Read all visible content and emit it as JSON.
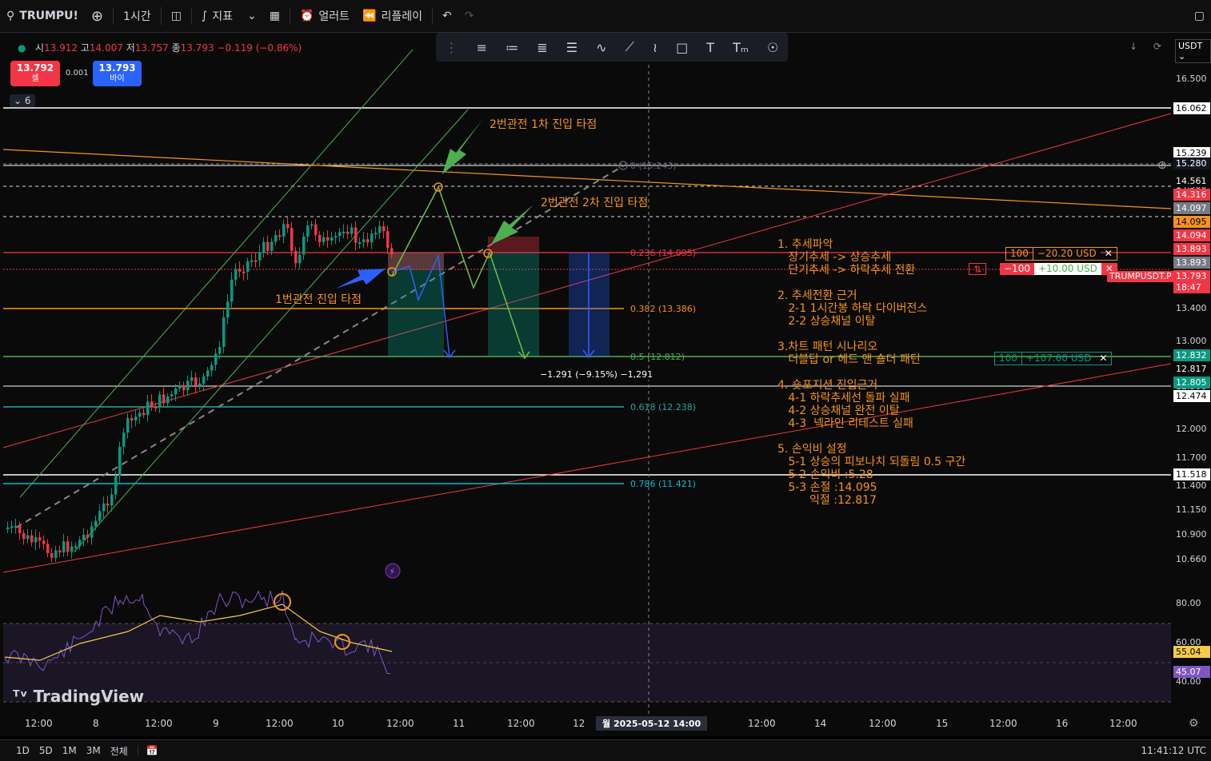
{
  "toolbar": {
    "symbol": "TRUMPU!",
    "interval": "1시간",
    "indicators": "지표",
    "alert": "얼러트",
    "replay": "리플레이"
  },
  "legend": {
    "open_label": "시",
    "open": "13.912",
    "high_label": "고",
    "high": "14.007",
    "low_label": "저",
    "low": "13.757",
    "close_label": "종",
    "close": "13.793",
    "change": "−0.119 (−0.86%)"
  },
  "trade": {
    "sell_price": "13.792",
    "sell_label": "셀",
    "spread": "0.001",
    "buy_price": "13.793",
    "buy_label": "바이"
  },
  "indicator_count": "6",
  "currency": "USDT",
  "fib_labels": [
    {
      "text": "0 (15.243)"
    },
    {
      "text": "0.236 (14.095)"
    },
    {
      "text": "0.382 (13.386)"
    },
    {
      "text": "0.5 (12.812)"
    },
    {
      "text": "0.618 (12.238)"
    },
    {
      "text": "0.786 (11.421)"
    }
  ],
  "measure": "−1.291 (−9.15%) −1,291",
  "annotations": {
    "entry1": "1번관전 진입 타점",
    "entry2_first": "2번관전 1차 진입 타점",
    "entry2_second": "2번관전 2차 진입 타점",
    "analysis": "1. 추세파악\n   장기추세 -> 상승추세\n   단기추세 -> 하락추세 전환\n\n2. 추세전환 근거\n   2-1 1시간봉 하락 다이버전스\n   2-2 상승채널 이탈\n\n3.차트 패턴 시나리오\n   더블탑 or 헤드 앤 숄더 패턴\n\n4. 숏포지션 진입근거\n   4-1 하락추세선 돌파 실패\n   4-2 상승채널 완전 이탈\n   4-3  넥라인 리테스트 실패\n\n5. 손익비 설정\n   5-1 상승의 피보나치 되돌림 0.5 구간\n   5-2 손익비 :5.28\n   5-3 손절 :14.095\n         익절 :12.817"
  },
  "positions": [
    {
      "qty": "100",
      "pnl": "−20.20 USD"
    },
    {
      "qty": "−100",
      "pnl": "+10.00 USD"
    },
    {
      "qty": "100",
      "pnl": "+107.60 USD"
    }
  ],
  "price_axis": {
    "ticks": [
      "16.500",
      "15.500",
      "14.500",
      "13.400",
      "13.000",
      "12.500",
      "12.000",
      "11.700",
      "11.400",
      "11.150",
      "10.900",
      "10.660",
      "80.00",
      "60.00",
      "40.00"
    ],
    "labels": [
      {
        "text": "16.062",
        "bg": "#ffffff",
        "fg": "#000000"
      },
      {
        "text": "15.239",
        "bg": "#ffffff",
        "fg": "#000000"
      },
      {
        "text": "15.280",
        "bg": "#131722",
        "fg": "#ffffff"
      },
      {
        "text": "14.561",
        "bg": "#0a0a0a",
        "fg": "#ffffff"
      },
      {
        "text": "14.316",
        "bg": "#f23645",
        "fg": "#ffffff"
      },
      {
        "text": "14.097",
        "bg": "#787b86",
        "fg": "#ffffff"
      },
      {
        "text": "14.095",
        "bg": "#f7931a",
        "fg": "#000000"
      },
      {
        "text": "14.094",
        "bg": "#f23645",
        "fg": "#ffffff"
      },
      {
        "text": "13.893",
        "bg": "#f23645",
        "fg": "#ffffff"
      },
      {
        "text": "13.893",
        "bg": "#787b86",
        "fg": "#ffffff"
      },
      {
        "text": "13.793",
        "bg": "#f23645",
        "fg": "#ffffff"
      },
      {
        "text": "18:47",
        "bg": "#f23645",
        "fg": "#ffffff"
      },
      {
        "text": "12.832",
        "bg": "#089981",
        "fg": "#ffffff"
      },
      {
        "text": "12.817",
        "bg": "#0a0a0a",
        "fg": "#ffffff"
      },
      {
        "text": "12.805",
        "bg": "#089981",
        "fg": "#ffffff"
      },
      {
        "text": "12.474",
        "bg": "#ffffff",
        "fg": "#000000"
      },
      {
        "text": "11.518",
        "bg": "#ffffff",
        "fg": "#000000"
      },
      {
        "text": "55.04",
        "bg": "#f7c948",
        "fg": "#000000"
      },
      {
        "text": "45.07",
        "bg": "#7e57c2",
        "fg": "#ffffff"
      }
    ]
  },
  "symbol_tag": "TRUMPUSDT.P",
  "time_axis": [
    "12:00",
    "8",
    "12:00",
    "9",
    "12:00",
    "10",
    "12:00",
    "11",
    "12:00",
    "12",
    "12:00",
    "14",
    "12:00",
    "15",
    "12:00",
    "16",
    "12:00"
  ],
  "crosshair_time": "월 2025-05-12   14:00",
  "ranges": [
    "1D",
    "5D",
    "1M",
    "3M",
    "전체"
  ],
  "clock": "11:41:12 UTC",
  "watermark": "TradingView",
  "colors": {
    "up": "#089981",
    "down": "#f23645",
    "orange": "#f7931a",
    "fib_green": "#4caf50"
  }
}
